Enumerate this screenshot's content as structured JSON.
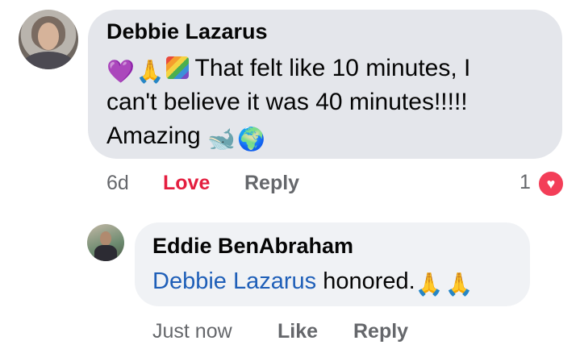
{
  "comment": {
    "author": "Debbie Lazarus",
    "line1_text": "That felt like 10 minutes, I",
    "line2_text": "can't believe it was 40 minutes!!!!!",
    "line3_text": "Amazing",
    "emoji": {
      "heart": "💜",
      "pray": "🙏",
      "rainbow": "rainbow-emoji",
      "whale": "🐋",
      "globe": "🌍"
    },
    "actions": {
      "time": "6d",
      "love": "Love",
      "reply": "Reply"
    },
    "reaction_count": "1",
    "reaction_icon": "heart-reaction-icon"
  },
  "reply": {
    "author": "Eddie BenAbraham",
    "mention": "Debbie Lazarus",
    "text": "honored.",
    "emoji": {
      "pray": "🙏"
    },
    "actions": {
      "time": "Just now",
      "like": "Like",
      "reply": "Reply"
    }
  },
  "colors": {
    "bubble_main": "#e4e6eb",
    "bubble_reply": "#f0f2f5",
    "love": "#e41e3f",
    "mention": "#1f5fb8",
    "secondary_text": "#65676b"
  }
}
